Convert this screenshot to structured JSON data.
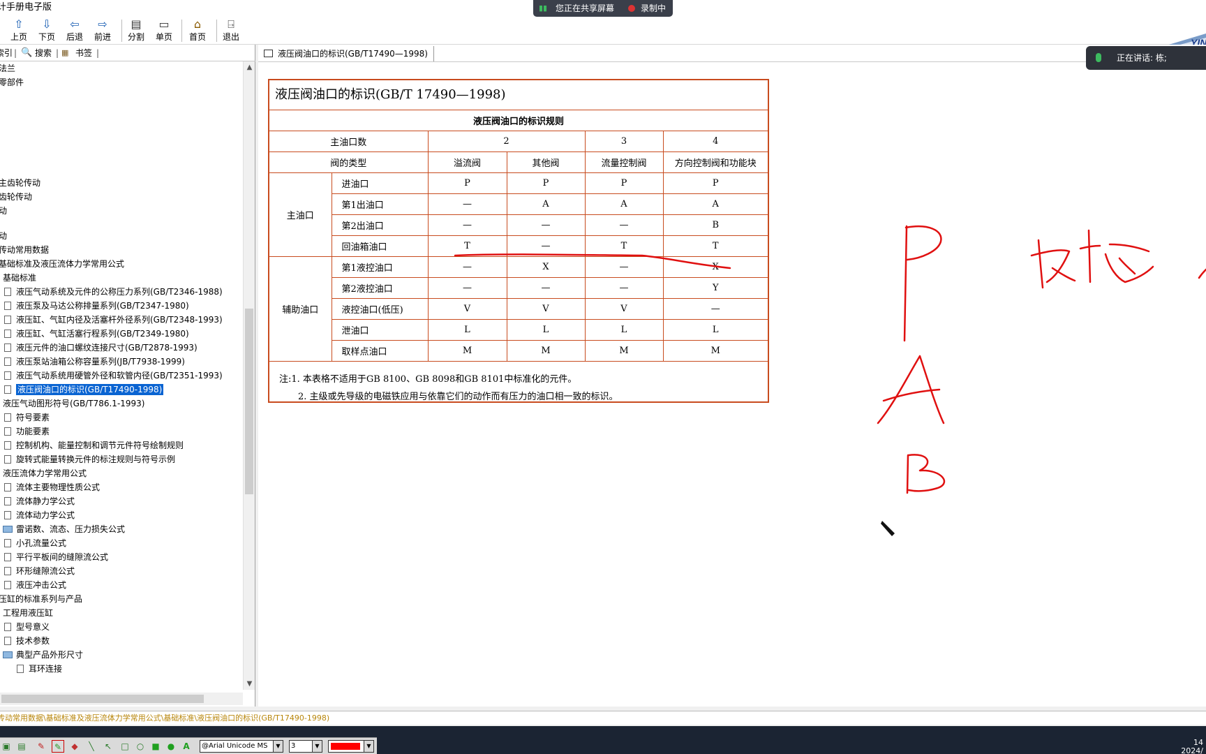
{
  "window": {
    "title": "计手册电子版"
  },
  "toolbar": {
    "buttons": [
      {
        "label": "上页",
        "icon": "arrow-up-icon"
      },
      {
        "label": "下页",
        "icon": "arrow-down-icon"
      },
      {
        "label": "后退",
        "icon": "arrow-left-icon"
      },
      {
        "label": "前进",
        "icon": "arrow-right-icon"
      },
      {
        "label": "分割",
        "icon": "split-icon"
      },
      {
        "label": "单页",
        "icon": "page-icon"
      },
      {
        "label": "首页",
        "icon": "home-icon"
      },
      {
        "label": "退出",
        "icon": "exit-icon"
      }
    ]
  },
  "share": {
    "sharing": "您正在共享屏幕",
    "recording": "录制中",
    "speaking": "正在讲话: 栋;"
  },
  "left_tabs": [
    "索引",
    "搜索",
    "书签"
  ],
  "tree": [
    "法兰",
    "零部件",
    "主齿轮传动",
    "齿轮传动",
    "动",
    "动",
    "传动常用数据",
    "基础标准及液压流体力学常用公式",
    "基础标准",
    "液压气动系统及元件的公称压力系列(GB/T2346-1988)",
    "液压泵及马达公称排量系列(GB/T2347-1980)",
    "液压缸、气缸内径及活塞杆外径系列(GB/T2348-1993)",
    "液压缸、气缸活塞行程系列(GB/T2349-1980)",
    "液压元件的油口螺纹连接尺寸(GB/T2878-1993)",
    "液压泵站油箱公称容量系列(JB/T7938-1999)",
    "液压气动系统用硬管外径和软管内径(GB/T2351-1993)",
    "液压阀油口的标识(GB/T17490-1998)",
    "液压气动图形符号(GB/T786.1-1993)",
    "符号要素",
    "功能要素",
    "控制机构、能量控制和调节元件符号绘制规则",
    "旋转式能量转换元件的标注规则与符号示例",
    "液压流体力学常用公式",
    "流体主要物理性质公式",
    "流体静力学公式",
    "流体动力学公式",
    "雷诺数、流态、压力损失公式",
    "小孔流量公式",
    "平行平板间的缝隙流公式",
    "环形缝隙流公式",
    "液压冲击公式",
    "压缸的标准系列与产品",
    "工程用液压缸",
    "型号意义",
    "技术参数",
    "典型产品外形尺寸",
    "耳环连接"
  ],
  "doc_tab": "液压阀油口的标识(GB/T17490—1998)",
  "doc": {
    "title": "液压阀油口的标识(GB/T 17490—1998)",
    "table_title": "液压阀油口的标识规则",
    "row_main_count": "主油口数",
    "main_count_values": [
      "2",
      "3",
      "4"
    ],
    "row_valve_type": "阀的类型",
    "valve_types": [
      "溢流阀",
      "其他阀",
      "流量控制阀",
      "方向控制阀和功能块"
    ],
    "group_main": "主油口",
    "group_aux": "辅助油口",
    "rows_main": [
      {
        "name": "进油口",
        "v": [
          "P",
          "P",
          "P",
          "P"
        ]
      },
      {
        "name": "第1出油口",
        "v": [
          "—",
          "A",
          "A",
          "A"
        ]
      },
      {
        "name": "第2出油口",
        "v": [
          "—",
          "—",
          "—",
          "B"
        ]
      },
      {
        "name": "回油箱油口",
        "v": [
          "T",
          "—",
          "T",
          "T"
        ]
      }
    ],
    "rows_aux": [
      {
        "name": "第1液控油口",
        "v": [
          "—",
          "X",
          "—",
          "X"
        ]
      },
      {
        "name": "第2液控油口",
        "v": [
          "—",
          "—",
          "—",
          "Y"
        ]
      },
      {
        "name": "液控油口(低压)",
        "v": [
          "V",
          "V",
          "V",
          "—"
        ]
      },
      {
        "name": "泄油口",
        "v": [
          "L",
          "L",
          "L",
          "L"
        ]
      },
      {
        "name": "取样点油口",
        "v": [
          "M",
          "M",
          "M",
          "M"
        ]
      }
    ],
    "note1": "注:1. 本表格不适用于GB 8100、GB 8098和GB 8101中标准化的元件。",
    "note2": "2. 主级或先导级的电磁铁应用与依靠它们的动作而有压力的油口相一致的标识。"
  },
  "ink_colors": {
    "pen": "#e01010"
  },
  "status_path": "传动常用数据\\基础标准及液压流体力学常用公式\\基础标准\\液压阀油口的标识(GB/T17490-1998)",
  "penbar": {
    "font": "@Arial Unicode MS",
    "size": "3",
    "color": "#ff0000"
  },
  "clock": {
    "time": "14",
    "date": "2024/"
  }
}
